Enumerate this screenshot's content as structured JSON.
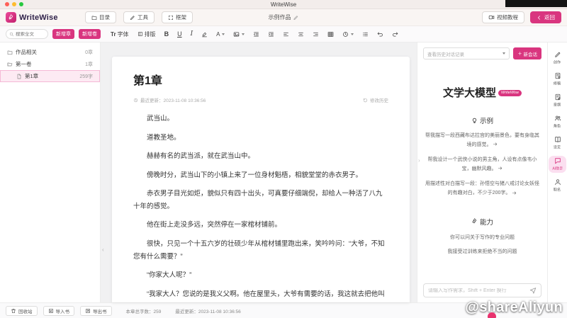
{
  "window": {
    "title": "WriteWise"
  },
  "header": {
    "brand": "WriteWise",
    "menu_catalog": "目录",
    "menu_tools": "工具",
    "menu_frame": "框架",
    "doc_title": "示例作品",
    "video_tutorial": "视频教程",
    "back": "返回"
  },
  "toolbar": {
    "search_placeholder": "搜索全文",
    "add_chapter": "新增章",
    "add_volume": "新增卷",
    "font_prefix": "Tr",
    "font": "字体",
    "layout": "排版",
    "bold": "B",
    "underline": "U",
    "italic": "I",
    "color_letter": "A"
  },
  "sidebar": {
    "items": [
      {
        "label": "作品相关",
        "count": "0章"
      },
      {
        "label": "第一卷",
        "count": "1章"
      },
      {
        "label": "第1章",
        "count": "259字"
      }
    ]
  },
  "editor": {
    "title": "第1章",
    "updated": "最近更新：2023-11-08 10:36:56",
    "history": "修改历史",
    "paragraphs": [
      "武当山。",
      "道教圣地。",
      "赫赫有名的武当派，就在武当山中。",
      "傍晚时分，武当山下的小镇上来了一位身材魁梧，相貌堂堂的赤衣男子。",
      "赤衣男子目光如炬，貌似只有四十出头，可真要仔细端倪，却给人一种活了八九十年的感觉。",
      "他在街上走没多远，突然停在一家棺材铺前。",
      "很快，只见一个十五六岁的壮硕少年从棺材铺里跑出来，笑吟吟问：“大爷，不知您有什么需要？”",
      "“你家大人呢？”",
      "“我家大人？您说的是我义父啊。他在屋里头，大爷有需要的话，我这就去把他叫来。”"
    ]
  },
  "assistant": {
    "history_select": "查看历史对话记录",
    "new_session": "新会话",
    "model_title": "文学大模型",
    "model_badge": "WriteWise",
    "examples_title": "示例",
    "examples": [
      "帮我描写一段西藏布达拉宫的美丽景色，要有身临其境的感觉。",
      "帮我设计一个武侠小说的男主角，人设有点像韦小宝，幽默风趣。",
      "用描述性对白描写一段：孙悟空与猪八戒讨论女妖怪的有趣对白，不少于200字。"
    ],
    "ability_title": "能力",
    "abilities": [
      "你可以问关于写作的专业问题",
      "我接受过训练来拒绝不当的问题"
    ],
    "input_placeholder": "请输入写作需求，Shift + Enter 换行"
  },
  "rail": {
    "items": [
      {
        "label": "创作"
      },
      {
        "label": "修稿"
      },
      {
        "label": "章纲"
      },
      {
        "label": "角色"
      },
      {
        "label": "设定"
      },
      {
        "label": "AI助手"
      },
      {
        "label": "取名"
      }
    ]
  },
  "statusbar": {
    "recycle_bin": "回收站",
    "import_book": "导入书",
    "export_book": "导出书",
    "word_count": "本章总字数：259",
    "updated": "最近更新：2023-11-08 10:36:56"
  },
  "watermark": "@shareAliyun",
  "colors": {
    "accent": "#d9357f"
  }
}
